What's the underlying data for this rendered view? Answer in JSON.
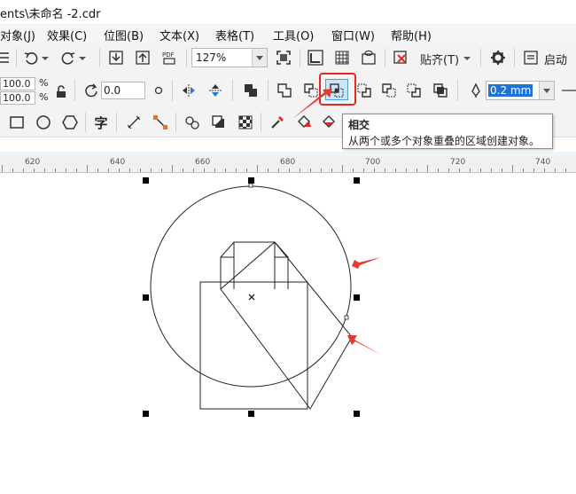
{
  "window": {
    "title": "ents\\未命名 -2.cdr"
  },
  "menu": [
    "对象(J)",
    "效果(C)",
    "位图(B)",
    "文本(X)",
    "表格(T)",
    "工具(O)",
    "窗口(W)",
    "帮助(H)"
  ],
  "toolbar": {
    "zoom_value": "127%",
    "snap_label": "贴齐(T)",
    "launch_label": "启动",
    "pdf_label": "PDF"
  },
  "propertybar": {
    "scale_x": "100.0",
    "scale_y": "100.0",
    "percent": "%",
    "rotation": "0.0",
    "outline_width": "0.2 mm"
  },
  "text_tool_glyph": "字",
  "tooltip": {
    "title": "相交",
    "description": "从两个或多个对象重叠的区域创建对象。"
  },
  "ruler": {
    "labels": [
      "620",
      "640",
      "660",
      "680",
      "700",
      "720",
      "740"
    ]
  },
  "colors": {
    "highlight": "#e02a2a",
    "arrow": "#e53935",
    "selected_button": "#cde6f7"
  }
}
